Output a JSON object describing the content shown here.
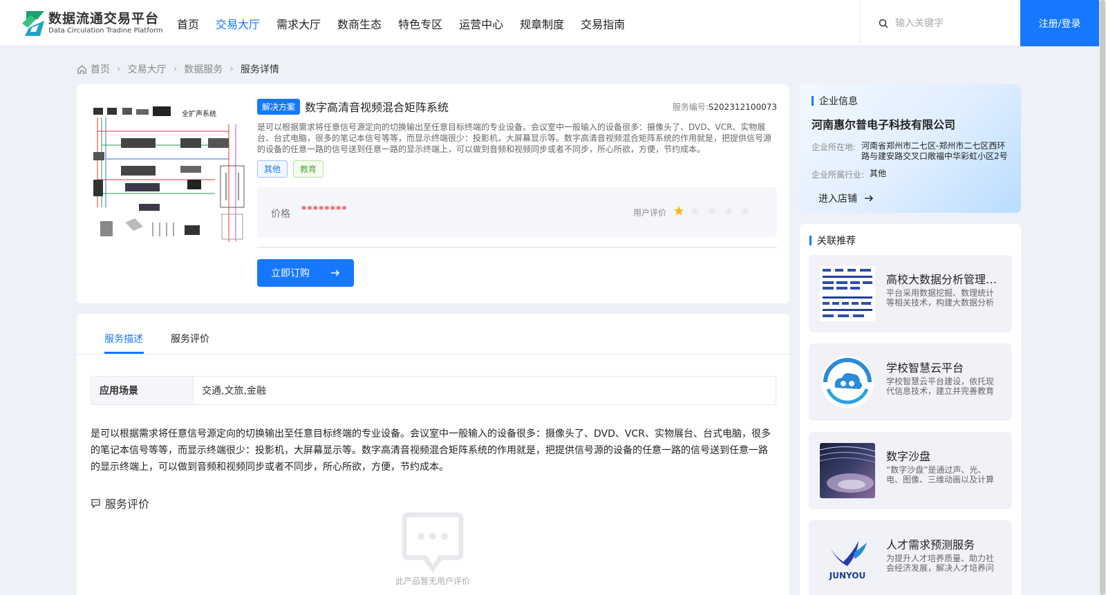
{
  "header": {
    "logo_cn": "数据流通交易平台",
    "logo_en": "Data Circulation Tradine Platform",
    "nav": [
      "首页",
      "交易大厅",
      "需求大厅",
      "数商生态",
      "特色专区",
      "运营中心",
      "规章制度",
      "交易指南"
    ],
    "active_nav": "交易大厅",
    "search_placeholder": "输入关键字",
    "login_label": "注册/登录",
    "accent": "#1677ff"
  },
  "breadcrumb": [
    "首页",
    "交易大厅",
    "数据服务",
    "服务详情"
  ],
  "product": {
    "badge": "解决方案",
    "title": "数字高清音视频混合矩阵系统",
    "code_label": "服务编号:",
    "code": "S202312100073",
    "description": "是可以根据需求将任意信号源定向的切换输出至任意目标终端的专业设备。会议室中一般输入的设备很多：摄像头了、DVD、VCR、实物展台、台式电脑，很多的笔记本信号等等，而显示终端很少：投影机，大屏幕显示等。数字高清音视频混合矩阵系统的作用就是，把提供信号源的设备的任意一路的信号送到任意一路的显示终端上，可以做到音频和视频同步或者不同步，所心所欲，方便，节约成本。",
    "tags": [
      "其他",
      "教育"
    ],
    "price_label": "价格",
    "price": "********",
    "rating_label": "用户评价",
    "rating": 1,
    "rating_max": 5,
    "subscribe_label": "立即订购",
    "diagram_label": "全扩声系统"
  },
  "tabs": [
    "服务描述",
    "服务评价"
  ],
  "detail": {
    "scene_key": "应用场景",
    "scene_value": "交通,文旅,金融",
    "long_description": "是可以根据需求将任意信号源定向的切换输出至任意目标终端的专业设备。会议室中一般输入的设备很多：摄像头了、DVD、VCR、实物展台、台式电脑，很多的笔记本信号等等，而显示终端很少：投影机，大屏幕显示等。数字高清音视频混合矩阵系统的作用就是，把提供信号源的设备的任意一路的信号送到任意一路的显示终端上，可以做到音频和视频同步或者不同步，所心所欲，方便，节约成本。",
    "review_title": "服务评价",
    "empty_review": "此产品暂无用户评价"
  },
  "company": {
    "section": "企业信息",
    "name": "河南惠尔普电子科技有限公司",
    "address_label": "企业所在地:",
    "address": "河南省郑州市二七区-郑州市二七区西环路与建安路交叉口敞福中华彩虹小区2号楼",
    "industry_label": "企业所属行业:",
    "industry": "其他",
    "enter_label": "进入店铺"
  },
  "recommend": {
    "section": "关联推荐",
    "items": [
      {
        "title": "高校大数据分析管理平台",
        "desc": "平台采用数据挖掘、数理统计等相关技术，构建大数据分析管理体系"
      },
      {
        "title": "学校智慧云平台",
        "desc": "学校智慧云平台建设，依托现代信息技术，建立并完善教育体系"
      },
      {
        "title": "数字沙盘",
        "desc": "“数字沙盘”是通过声、光、电、图像、三维动画以及计算机程控"
      },
      {
        "title": "人才需求预测服务",
        "desc": "为提升人才培养质量、助力社会经济发展，解决人才培养问题",
        "logo_text": "JUNYOU"
      }
    ]
  }
}
